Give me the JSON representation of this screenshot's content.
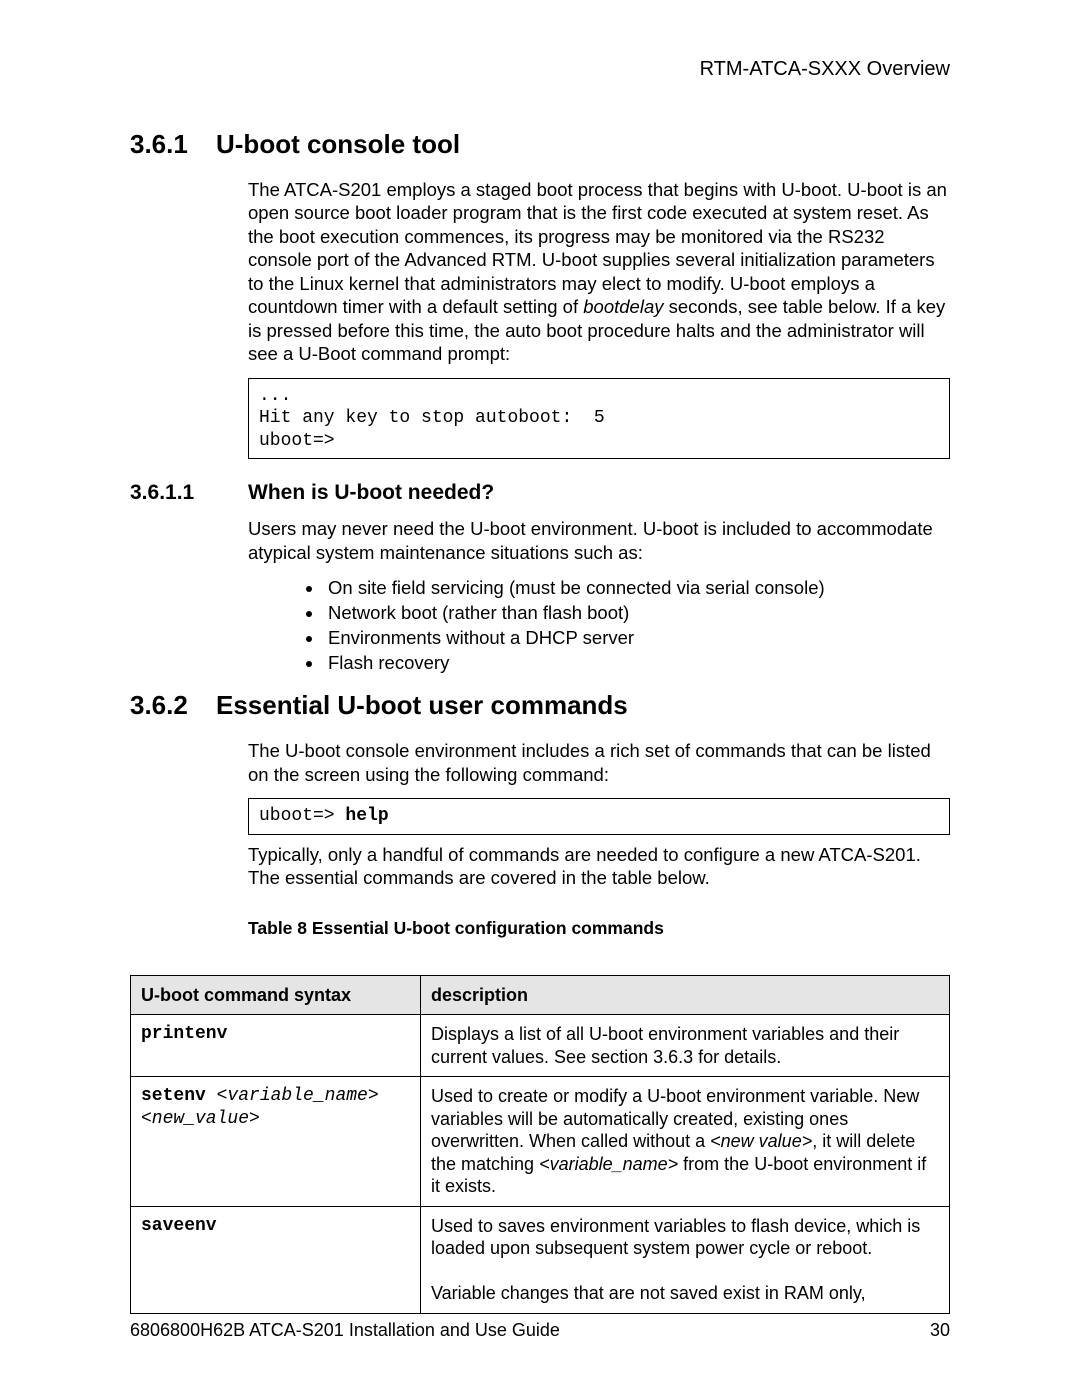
{
  "running_head": "RTM-ATCA-SXXX Overview",
  "sec_361": {
    "num": "3.6.1",
    "title": "U-boot console tool",
    "para_pre": "The ATCA-S201 employs a staged boot process that begins with U-boot. U-boot is an open source boot loader program that is the first code executed at system reset. As the boot execution commences, its progress may be monitored via the RS232 console port of the Advanced RTM.   U-boot supplies several initialization parameters to the Linux kernel that administrators may elect to modify.  U-boot employs a countdown timer with a default setting of ",
    "para_em": "bootdelay",
    "para_post": " seconds, see table below. If a key is pressed before this time, the auto boot procedure halts and the administrator will see a U-Boot command prompt:",
    "code": "...\nHit any key to stop autoboot:  5\nuboot=>"
  },
  "sec_3611": {
    "num": "3.6.1.1",
    "title": "When is U-boot needed?",
    "para": "Users may never need the U-boot environment.  U-boot is included to accommodate atypical system maintenance situations such as:",
    "bullets": [
      "On site field servicing (must be connected via serial console)",
      "Network boot (rather than flash boot)",
      "Environments without a DHCP server",
      "Flash recovery"
    ]
  },
  "sec_362": {
    "num": "3.6.2",
    "title": "Essential U-boot user commands",
    "para1": "The U-boot console environment includes a rich set of commands that can be listed on the screen using the following command:",
    "code_pre": "uboot=> ",
    "code_bold": "help",
    "para2": "Typically, only a handful of commands are needed to configure a new ATCA-S201. The essential commands are covered in the table below.",
    "table_caption": "Table 8 Essential U-boot configuration commands",
    "headers": {
      "c1": "U-boot command syntax",
      "c2": "description"
    },
    "rows": {
      "r1": {
        "cmd": "printenv",
        "desc": "Displays a list of all U-boot environment variables and their current values.  See section 3.6.3 for details."
      },
      "r2": {
        "cmd_bold": "setenv",
        "cmd_arg1": "<variable_name>",
        "cmd_arg2": "<new_value>",
        "desc_pre": "Used to create or modify a U-boot environment variable. New variables will be automatically created, existing ones overwritten.  When called without a ",
        "desc_em1": "<new value>",
        "desc_mid": ", it will delete the matching ",
        "desc_em2": "<variable_name>",
        "desc_post": " from the U-boot environment if it exists."
      },
      "r3": {
        "cmd": "saveenv",
        "desc": "Used to saves environment variables to flash device, which is loaded upon subsequent system power cycle or reboot.\n\nVariable changes that are not saved exist in RAM only,"
      }
    }
  },
  "footer": {
    "left": "6806800H62B ATCA-S201 Installation and Use Guide",
    "page": "30"
  }
}
